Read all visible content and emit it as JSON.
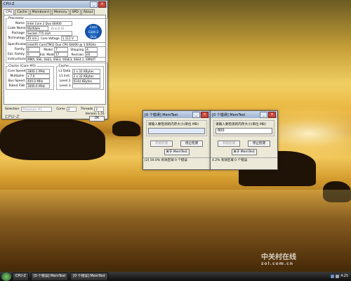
{
  "cpuz": {
    "window_title": "CPU-Z",
    "tabs": [
      "CPU",
      "Cache",
      "Mainboard",
      "Memory",
      "SPD",
      "About"
    ],
    "processor_group": "Processor",
    "name_label": "Name",
    "name_value": "Intel Core 2 Duo E8400",
    "codename_label": "Code Name",
    "codename_value": "Wolfdale",
    "brandid_label": "Brand ID",
    "package_label": "Package",
    "package_value": "Socket 775 LGA",
    "technology_label": "Technology",
    "technology_value": "45 nm",
    "corevoltage_label": "Core Voltage",
    "corevoltage_value": "1.112 V",
    "spec_label": "Specification",
    "spec_value": "Intel(R) Core(TM)2 Duo CPU   E8400 @ 3.00GHz",
    "family_label": "Family",
    "family_value": "6",
    "model_label": "Model",
    "model_value": "7",
    "stepping_label": "Stepping",
    "stepping_value": "A",
    "extfamily_label": "Ext. Family",
    "extfamily_value": "6",
    "extmodel_label": "Ext. Model",
    "extmodel_value": "17",
    "revision_label": "Revision",
    "revision_value": "E0",
    "instructions_label": "Instructions",
    "instructions_value": "MMX, SSE, SSE2, SSE3, SSSE3, SSE4.1, EM64T",
    "clocks_group": "Clocks (Core #0)",
    "corespeed_label": "Core Speed",
    "corespeed_value": "2800.1 MHz",
    "multiplier_label": "Multiplier",
    "multiplier_value": "x 7.0",
    "busspeed_label": "Bus Speed",
    "busspeed_value": "400.0 MHz",
    "ratedfsb_label": "Rated FSB",
    "ratedfsb_value": "1600.0 MHz",
    "cache_group": "Cache",
    "l1data_label": "L1 Data",
    "l1data_value": "2 x 32 KBytes",
    "l1inst_label": "L1 Inst.",
    "l1inst_value": "2 x 32 KBytes",
    "level2_label": "Level 2",
    "level2_value": "6144 KBytes",
    "level3_label": "Level 3",
    "selection_label": "Selection",
    "selection_value": "Processor #1",
    "cores_label": "Cores",
    "cores_value": "2",
    "threads_label": "Threads",
    "threads_value": "2",
    "version": "Version 1.51",
    "brand": "CPU-Z",
    "ok_label": "OK",
    "logo_line1": "intel",
    "logo_line2": "Core 2",
    "logo_line3": "Duo"
  },
  "memtest1": {
    "title": "[0 个错误] MemTest",
    "prompt": "请输入要检测的内存大小(单位 MB)",
    "input_value": "",
    "start_label": "开始检测",
    "stop_label": "停止检测",
    "about_label": "关于 MemTest",
    "status": "[2]   50.0% 有效区域   0 个错误"
  },
  "memtest2": {
    "title": "[0 个错误] MemTest",
    "prompt": "请输入要检测的内存大小(单位 MB)",
    "input_value": "800",
    "start_label": "开始检测",
    "stop_label": "停止检测",
    "about_label": "关于 MemTest",
    "status": "4.2%  有效区域   0 个错误"
  },
  "taskbar": {
    "items": [
      "CPU-Z",
      "[0 个错误] MemTest",
      "[0 个错误] MemTest"
    ],
    "clock": "4:25"
  },
  "watermark": {
    "main": "中关村在线",
    "sub": "zol.com.cn"
  }
}
